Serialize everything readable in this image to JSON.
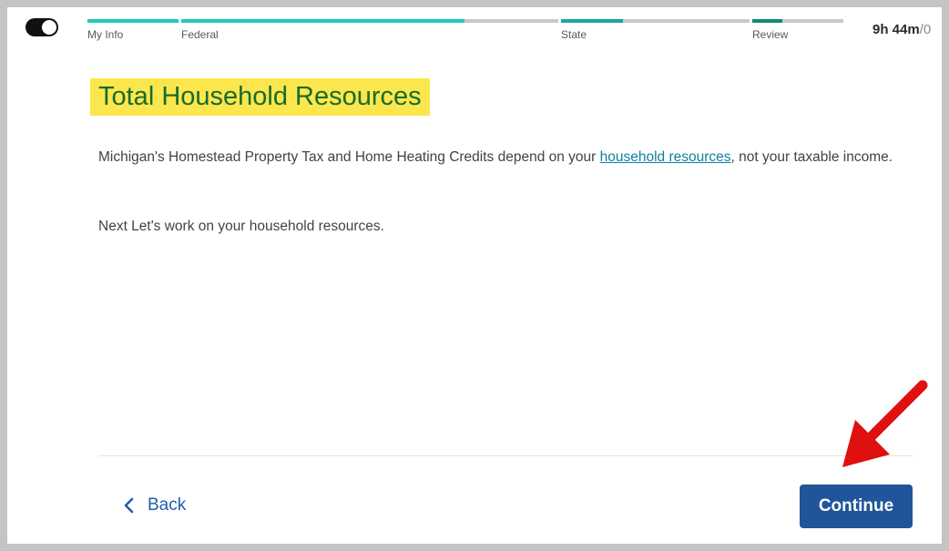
{
  "header": {
    "toggle": {
      "on": true
    },
    "progress": {
      "steps": [
        {
          "label": "My Info",
          "fill": 1.0,
          "color": "#23c9b6"
        },
        {
          "label": "Federal",
          "fill": 0.75,
          "color": "#23c9b6"
        },
        {
          "label": "State",
          "fill": 0.33,
          "color": "#1aa79b"
        },
        {
          "label": "Review",
          "fill": 0.33,
          "color": "#138a74"
        }
      ]
    },
    "timer": {
      "value": "9h 44m",
      "separator": "/",
      "total": "0"
    }
  },
  "main": {
    "title": "Total Household Resources",
    "paragraph1_before": "Michigan's Homestead Property Tax and Home Heating Credits depend on your ",
    "paragraph1_link": "household resources",
    "paragraph1_after": ", not your taxable income.",
    "paragraph2": "Next Let's work on your household resources."
  },
  "footer": {
    "back_label": "Back",
    "continue_label": "Continue"
  },
  "colors": {
    "highlight": "#fbe74d",
    "title_text": "#1a6a2a",
    "link": "#0d7f9e",
    "primary_button": "#20559a",
    "annotation_arrow": "#e01010"
  }
}
